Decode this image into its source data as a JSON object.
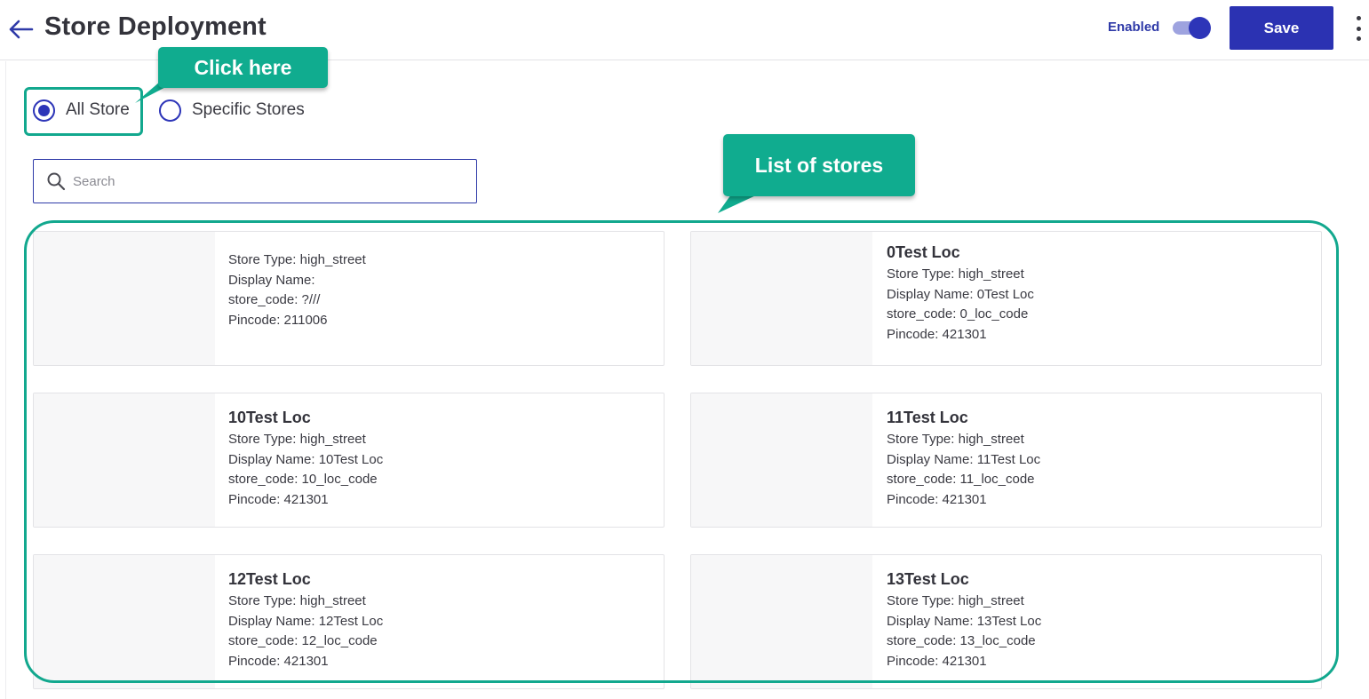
{
  "header": {
    "title": "Store Deployment",
    "enabled_label": "Enabled",
    "enabled": true,
    "save_label": "Save"
  },
  "deployment": {
    "options": [
      {
        "label": "All Store",
        "selected": true
      },
      {
        "label": "Specific Stores",
        "selected": false
      }
    ]
  },
  "search": {
    "placeholder": "Search",
    "value": ""
  },
  "stores": [
    {
      "name": "",
      "store_type": "Store Type: high_street",
      "display_name": "Display Name:",
      "store_code": "store_code: ?///",
      "pincode": "Pincode: 211006"
    },
    {
      "name": "0Test Loc",
      "store_type": "Store Type: high_street",
      "display_name": "Display Name: 0Test Loc",
      "store_code": "store_code: 0_loc_code",
      "pincode": "Pincode: 421301"
    },
    {
      "name": "10Test Loc",
      "store_type": "Store Type: high_street",
      "display_name": "Display Name: 10Test Loc",
      "store_code": "store_code: 10_loc_code",
      "pincode": "Pincode: 421301"
    },
    {
      "name": "11Test Loc",
      "store_type": "Store Type: high_street",
      "display_name": "Display Name: 11Test Loc",
      "store_code": "store_code: 11_loc_code",
      "pincode": "Pincode: 421301"
    },
    {
      "name": "12Test Loc",
      "store_type": "Store Type: high_street",
      "display_name": "Display Name: 12Test Loc",
      "store_code": "store_code: 12_loc_code",
      "pincode": "Pincode: 421301"
    },
    {
      "name": "13Test Loc",
      "store_type": "Store Type: high_street",
      "display_name": "Display Name: 13Test Loc",
      "store_code": "store_code: 13_loc_code",
      "pincode": "Pincode: 421301"
    }
  ],
  "annotations": {
    "click_here": "Click here",
    "list_of_stores": "List of stores"
  },
  "colors": {
    "primary": "#2b32b2",
    "annotation": "#10ac8f"
  },
  "icons": {
    "back": "arrow-left-icon",
    "search": "search-icon",
    "more": "more-vertical-icon"
  }
}
